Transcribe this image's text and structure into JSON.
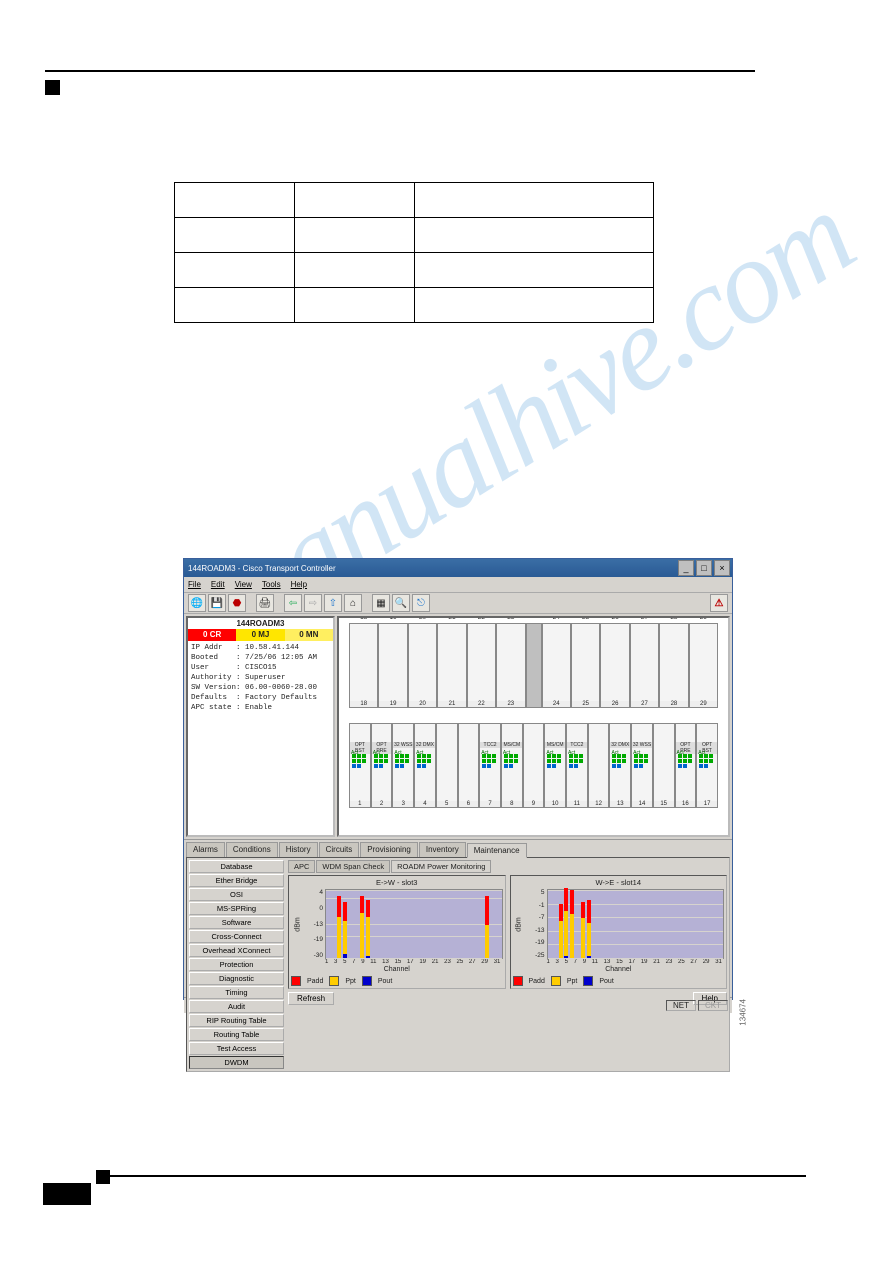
{
  "watermark": "manualhive.com",
  "app": {
    "title": "144ROADM3 - Cisco Transport Controller",
    "menus": [
      "File",
      "Edit",
      "View",
      "Tools",
      "Help"
    ],
    "win_buttons": [
      "_",
      "□",
      "×"
    ]
  },
  "node": {
    "name": "144ROADM3",
    "alarms": {
      "cr": "0 CR",
      "mj": "0 MJ",
      "mn": "0 MN"
    },
    "info_text": "IP Addr   : 10.58.41.144\nBooted    : 7/25/06 12:05 AM\nUser      : CISCO15\nAuthority : Superuser\nSW Version: 06.00-0060-28.00\nDefaults  : Factory Defaults\nAPC state : Enable"
  },
  "shelf": {
    "top_slots": [
      "18",
      "19",
      "20",
      "21",
      "22",
      "23",
      "",
      "24",
      "25",
      "26",
      "27",
      "28",
      "29"
    ],
    "bottom_slots": [
      "1",
      "2",
      "3",
      "4",
      "5",
      "6",
      "7",
      "8",
      "9",
      "10",
      "11",
      "12",
      "13",
      "14",
      "15",
      "16",
      "17"
    ],
    "labels": {
      "opt_bst": "OPT BST",
      "opt_pre": "OPT PRE",
      "wss32": "32 WSS",
      "dmx32": "32 DMX",
      "tcc": "TCC2",
      "ms_cm": "MS/CM",
      "tcc2p": "TCC2 P",
      "act": "Act",
      "sby": "Sby"
    }
  },
  "tabs": {
    "main": [
      "Alarms",
      "Conditions",
      "History",
      "Circuits",
      "Provisioning",
      "Inventory",
      "Maintenance"
    ],
    "main_active": "Maintenance",
    "side": [
      "Database",
      "Ether Bridge",
      "OSI",
      "MS-SPRing",
      "Software",
      "Cross-Connect",
      "Overhead XConnect",
      "Protection",
      "Diagnostic",
      "Timing",
      "Audit",
      "RIP Routing Table",
      "Routing Table",
      "Test Access",
      "DWDM"
    ],
    "side_active": "DWDM",
    "sub": [
      "APC",
      "WDM Span Check",
      "ROADM Power Monitoring"
    ],
    "sub_active": "ROADM Power Monitoring"
  },
  "buttons": {
    "refresh": "Refresh",
    "help": "Help"
  },
  "status": {
    "net": "NET",
    "ckt": "CKT"
  },
  "legend": {
    "padd": "Padd",
    "ppt": "Ppt",
    "pout": "Pout"
  },
  "figno": "134674",
  "chart_data": [
    {
      "type": "bar",
      "title": "E->W - slot3",
      "xlabel": "Channel",
      "ylabel": "dBm",
      "ylim": [
        -30,
        4
      ],
      "yticks": [
        4,
        0,
        -13,
        -19,
        -30
      ],
      "xticks": [
        1,
        3,
        5,
        7,
        9,
        11,
        13,
        15,
        17,
        19,
        21,
        23,
        25,
        27,
        29,
        31
      ],
      "series_names": [
        "Padd",
        "Ppt",
        "Pout"
      ],
      "series_colors": [
        "#ff0000",
        "#ffcc00",
        "#0000cc"
      ],
      "stacks": [
        {
          "x": 3,
          "Padd": 0,
          "Ppt": -10,
          "Pout": -30
        },
        {
          "x": 4,
          "Padd": -3,
          "Ppt": -12,
          "Pout": -28
        },
        {
          "x": 7,
          "Padd": 0,
          "Ppt": -8,
          "Pout": -30
        },
        {
          "x": 8,
          "Padd": -2,
          "Ppt": -10,
          "Pout": -29
        },
        {
          "x": 29,
          "Padd": 0,
          "Ppt": -14,
          "Pout": -30
        }
      ]
    },
    {
      "type": "bar",
      "title": "W->E - slot14",
      "xlabel": "Channel",
      "ylabel": "dBm",
      "ylim": [
        -25,
        5
      ],
      "yticks": [
        5,
        -1,
        -7,
        -13,
        -19,
        -25
      ],
      "xticks": [
        1,
        3,
        5,
        7,
        9,
        11,
        13,
        15,
        17,
        19,
        21,
        23,
        25,
        27,
        29,
        31
      ],
      "series_names": [
        "Padd",
        "Ppt",
        "Pout"
      ],
      "series_colors": [
        "#ff0000",
        "#ffcc00",
        "#0000cc"
      ],
      "stacks": [
        {
          "x": 3,
          "Padd": -2,
          "Ppt": -9,
          "Pout": -25
        },
        {
          "x": 4,
          "Padd": 5,
          "Ppt": -5,
          "Pout": -24
        },
        {
          "x": 5,
          "Padd": 4,
          "Ppt": -6,
          "Pout": -25
        },
        {
          "x": 7,
          "Padd": -1,
          "Ppt": -8,
          "Pout": -25
        },
        {
          "x": 8,
          "Padd": 0,
          "Ppt": -10,
          "Pout": -24
        }
      ]
    }
  ]
}
